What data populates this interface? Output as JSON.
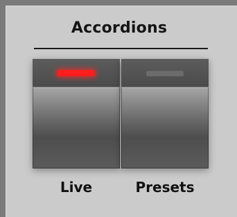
{
  "section": {
    "title": "Accordions"
  },
  "buttons": [
    {
      "label": "Live",
      "led": "on",
      "led_color": "#ff1d1d"
    },
    {
      "label": "Presets",
      "led": "off",
      "led_color": "#6c6c6c"
    }
  ]
}
